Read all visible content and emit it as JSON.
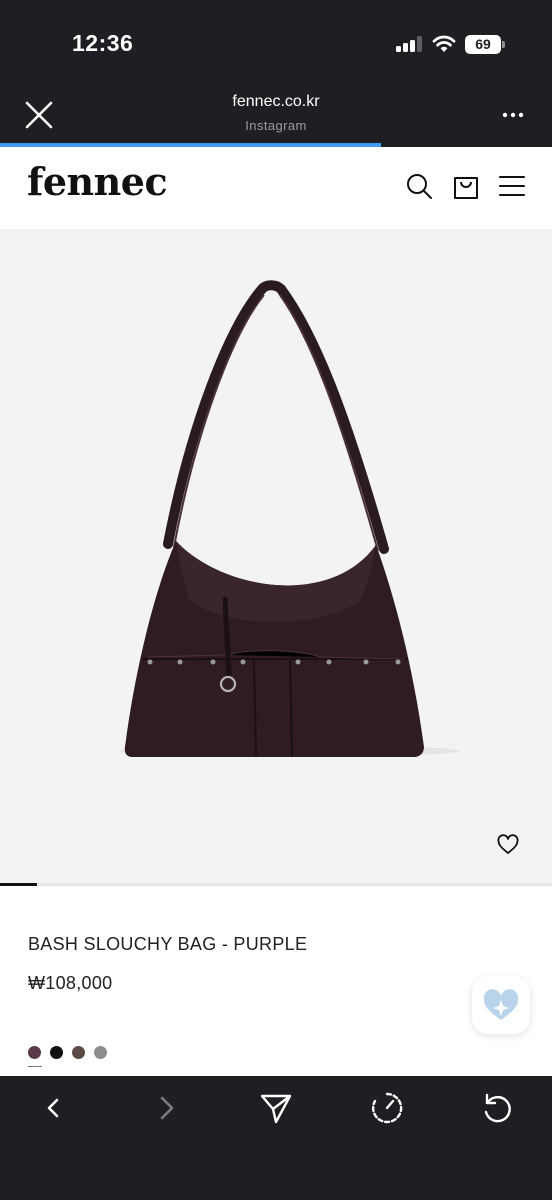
{
  "status_bar": {
    "time": "12:36",
    "battery": "69",
    "icons": [
      "cellular-signal-icon",
      "wifi-icon",
      "battery-icon"
    ]
  },
  "browser": {
    "url": "fennec.co.kr",
    "source": "Instagram",
    "load_progress": 0.69,
    "icons": [
      "close-icon",
      "more-icon"
    ]
  },
  "site": {
    "logo": "fennec",
    "icons": [
      "search-icon",
      "shopping-bag-icon",
      "menu-icon"
    ]
  },
  "product": {
    "name": "BASH SLOUCHY BAG - PURPLE",
    "price": "₩108,000",
    "image_icon": "shoulder-bag-image",
    "gallery_total": 15,
    "gallery_current": 1,
    "colors": [
      "#5a3a48",
      "#111111",
      "#5e4a44",
      "#8c8c8c"
    ],
    "selected_color_index": 0
  },
  "toolbar": {
    "icons": [
      "back-icon",
      "forward-icon",
      "share-icon",
      "speed-icon",
      "reload-icon"
    ]
  }
}
